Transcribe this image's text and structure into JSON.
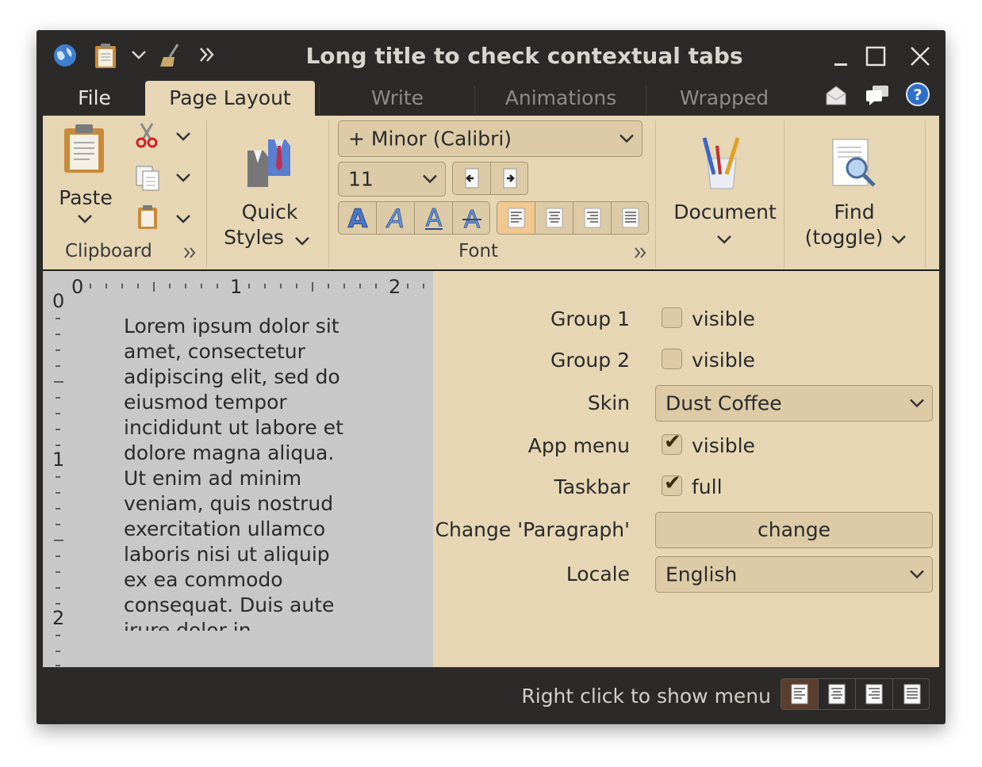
{
  "window": {
    "title": "Long title to check contextual tabs"
  },
  "titlebar": {
    "icons": [
      "globe-icon",
      "clipboard-icon",
      "chevron-down-icon",
      "broom-icon",
      "double-chevron-icon"
    ],
    "minimize": "minimize-icon",
    "maximize": "maximize-icon",
    "close": "close-icon"
  },
  "tabs": {
    "file": "File",
    "items": [
      "Page Layout",
      "Write",
      "Animations",
      "Wrapped"
    ],
    "active": "Page Layout"
  },
  "ribbon": {
    "clipboard": {
      "paste": "Paste",
      "title": "Clipboard"
    },
    "quick_styles": {
      "line1": "Quick",
      "line2": "Styles"
    },
    "font": {
      "title": "Font",
      "family": "+ Minor (Calibri)",
      "size": "11"
    },
    "document": "Document",
    "find": {
      "line1": "Find",
      "line2": "(toggle)"
    }
  },
  "ruler": {
    "h": [
      "0",
      "1",
      "2"
    ],
    "v": [
      "0",
      "1",
      "2"
    ]
  },
  "document": {
    "text": "Lorem ipsum dolor sit amet, consectetur adipiscing elit, sed do eiusmod tempor incididunt ut labore et dolore magna aliqua. Ut enim ad minim veniam, quis nostrud exercitation ullamco laboris nisi ut aliquip ex ea commodo consequat. Duis aute irure dolor in"
  },
  "panel": {
    "group1": {
      "label": "Group 1",
      "check": "visible",
      "checked": false
    },
    "group2": {
      "label": "Group 2",
      "check": "visible",
      "checked": false
    },
    "skin": {
      "label": "Skin",
      "value": "Dust Coffee"
    },
    "app_menu": {
      "label": "App menu",
      "check": "visible",
      "checked": true
    },
    "taskbar": {
      "label": "Taskbar",
      "check": "full",
      "checked": true
    },
    "change_paragraph": {
      "label": "Change 'Paragraph'",
      "button": "change"
    },
    "locale": {
      "label": "Locale",
      "value": "English"
    }
  },
  "statusbar": {
    "text": "Right click to show menu"
  },
  "colors": {
    "chrome": "#2b2a28",
    "ribbon": "#e6d6b4",
    "document": "#c8c8c8",
    "selected": "#f0c890"
  }
}
